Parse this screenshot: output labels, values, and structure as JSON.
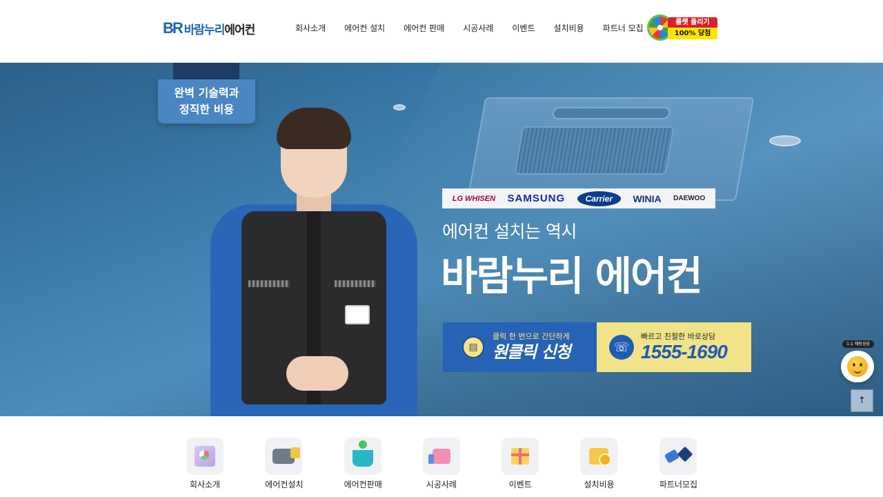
{
  "header": {
    "logo_mark": "BR",
    "logo_text_brand": "바람누리",
    "logo_text_suffix": "에어컨",
    "nav": [
      {
        "label": "회사소개"
      },
      {
        "label": "에어컨 설치"
      },
      {
        "label": "에어컨 판매"
      },
      {
        "label": "시공사례"
      },
      {
        "label": "이벤트"
      },
      {
        "label": "설치비용"
      },
      {
        "label": "파트너 모집"
      }
    ],
    "roulette": {
      "line1": "룰렛 돌리기",
      "line2": "100% 당첨"
    }
  },
  "hero": {
    "badge_line1": "완벽 기술력과",
    "badge_line2": "정직한 비용",
    "brands": [
      "LG WHISEN",
      "SAMSUNG",
      "Carrier",
      "WINIA",
      "DAEWOO"
    ],
    "subtitle": "에어컨 설치는 역시",
    "title": "바람누리 에어컨",
    "cta_apply": {
      "small": "클릭 한 번으로 간단하게",
      "big": "원클릭 신청"
    },
    "cta_call": {
      "small": "빠르고 친절한 바로상담",
      "big": "1555-1690"
    }
  },
  "floating": {
    "chat_tag": "1:1 채팅상담",
    "top_label": "↑"
  },
  "quick_menu": [
    {
      "label": "회사소개",
      "icon": "company-icon"
    },
    {
      "label": "에어컨설치",
      "icon": "install-truck-icon"
    },
    {
      "label": "에어컨판매",
      "icon": "shopping-basket-icon"
    },
    {
      "label": "시공사례",
      "icon": "thumbs-up-icon"
    },
    {
      "label": "이벤트",
      "icon": "gift-icon"
    },
    {
      "label": "설치비용",
      "icon": "coin-wallet-icon"
    },
    {
      "label": "파트너모집",
      "icon": "handshake-icon"
    }
  ],
  "colors": {
    "brand_blue": "#2763b5",
    "call_yellow": "#f1e389",
    "roulette_red": "#d9202c"
  }
}
